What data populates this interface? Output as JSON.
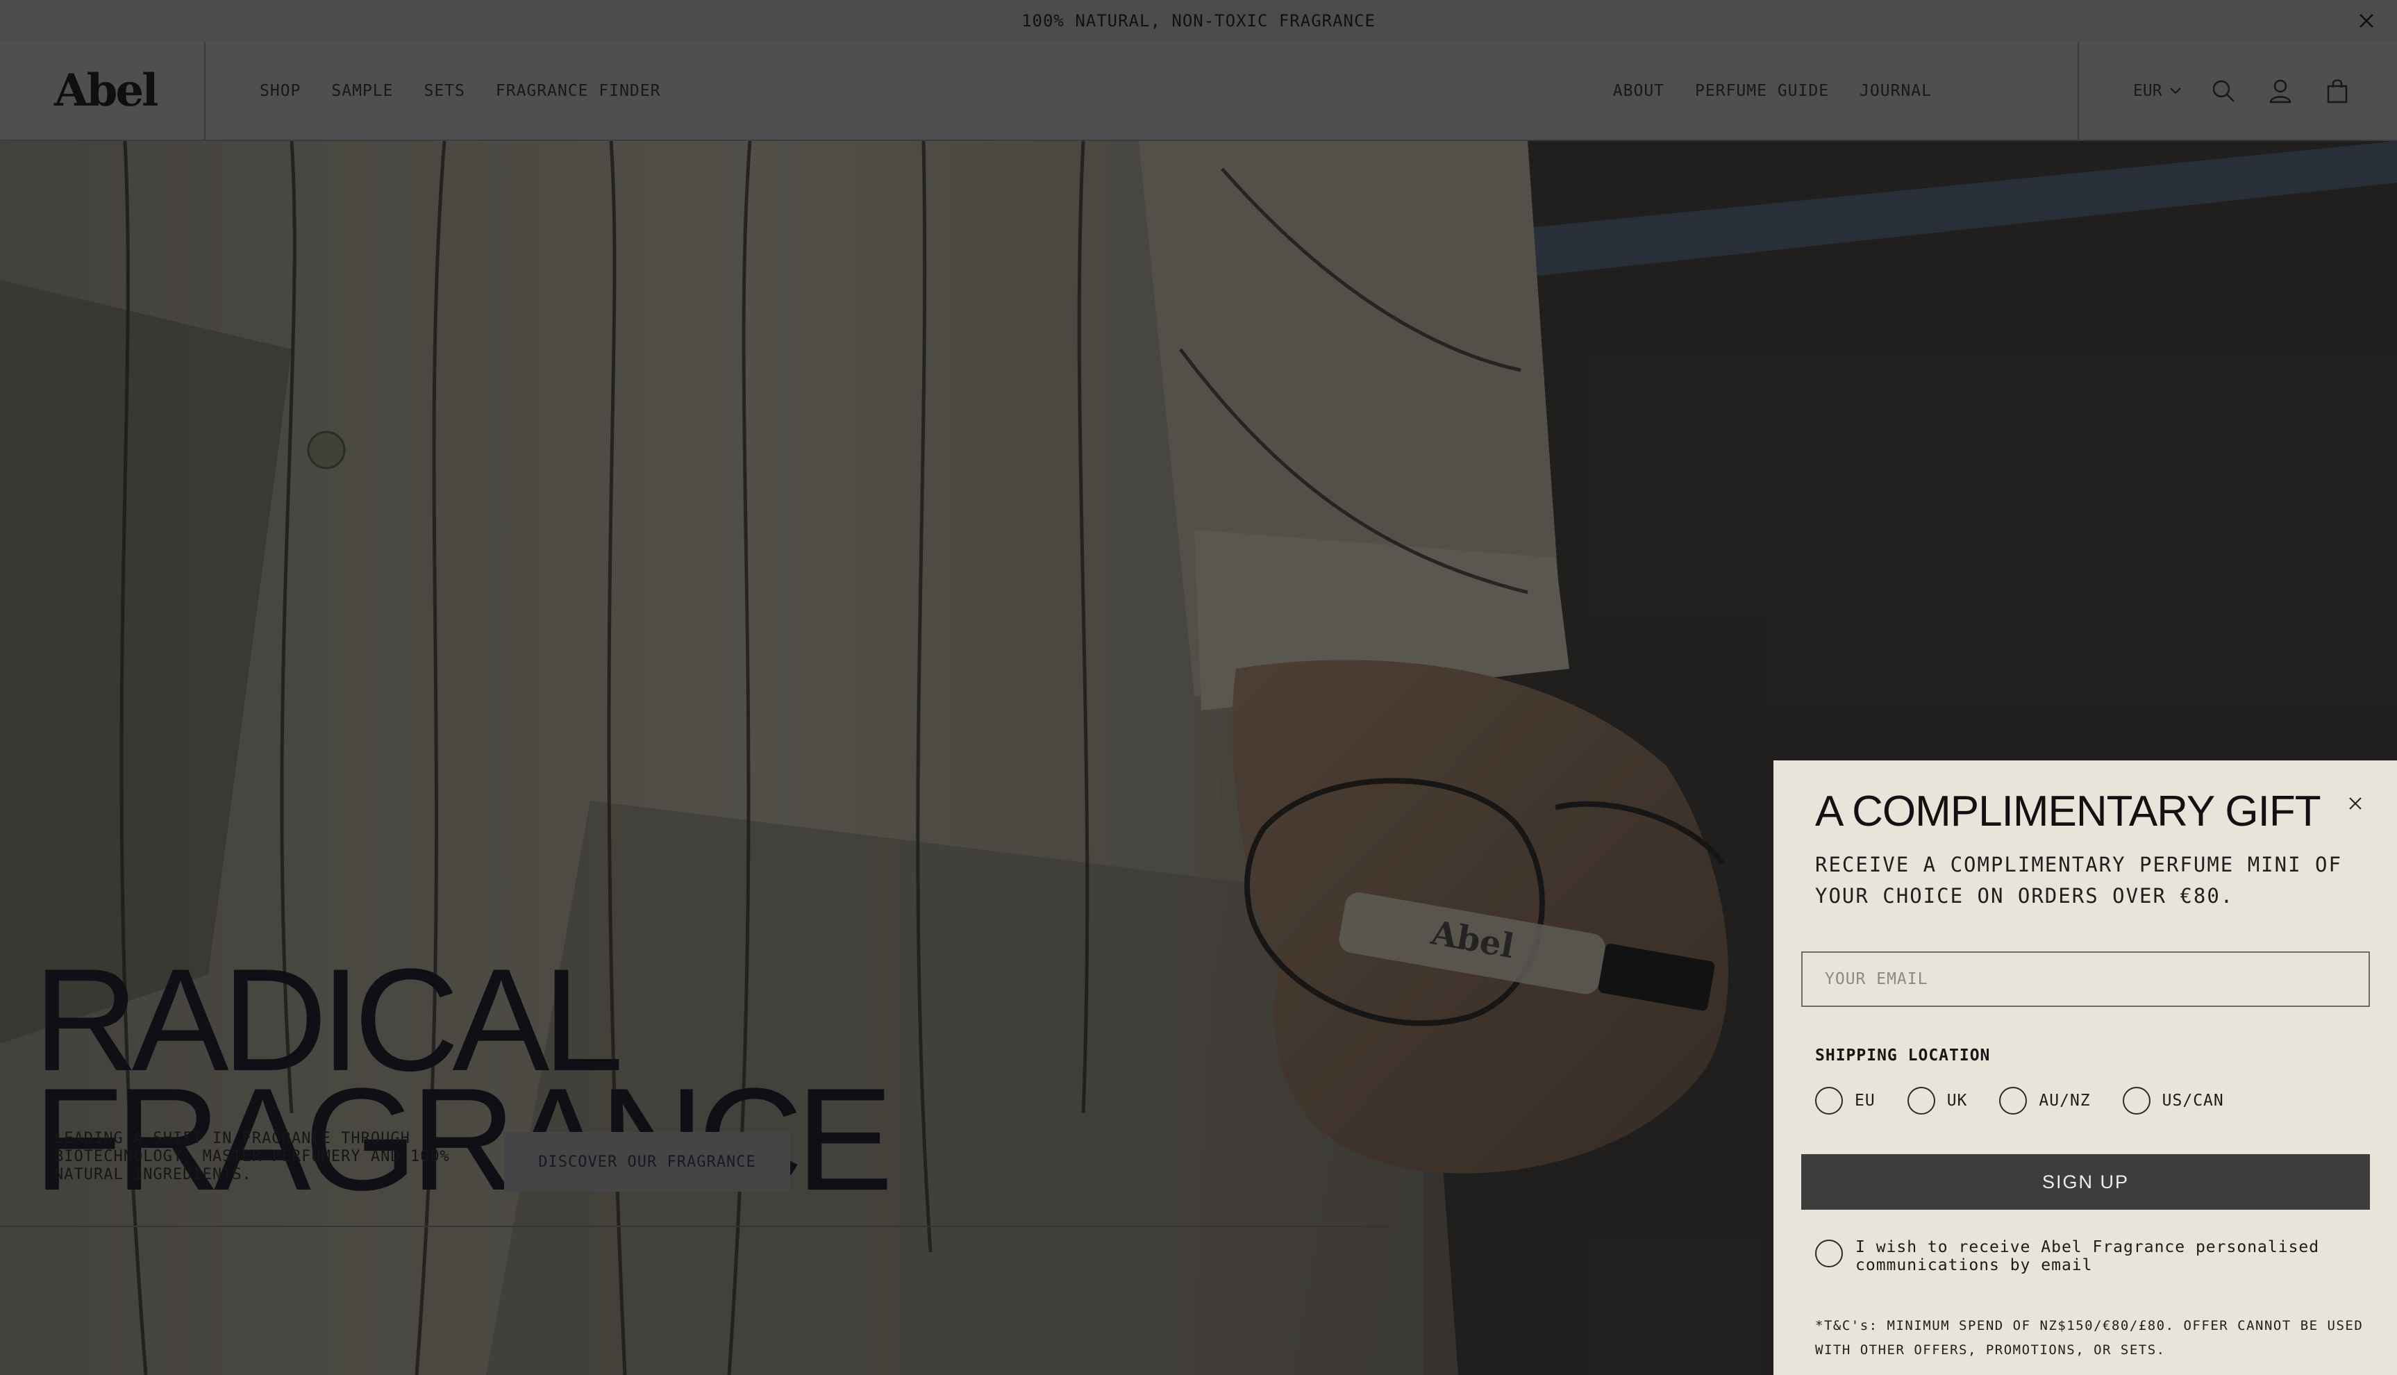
{
  "announcement": {
    "text": "100% NATURAL, NON-TOXIC FRAGRANCE"
  },
  "header": {
    "logo": "Abel",
    "nav_left": [
      "SHOP",
      "SAMPLE",
      "SETS",
      "FRAGRANCE FINDER"
    ],
    "nav_right": [
      "ABOUT",
      "PERFUME GUIDE",
      "JOURNAL"
    ],
    "currency": "EUR",
    "icons": [
      "search-icon",
      "account-icon",
      "cart-icon"
    ]
  },
  "hero": {
    "title_line1": "RADICAL",
    "title_line2": "FRAGRANCE",
    "subtitle": "LEADING A SHIFT IN FRAGRANCE THROUGH BIOTECHNOLOGY, MASTER PERFUMERY AND 100% NATURAL INGREDIENTS.",
    "cta": "DISCOVER OUR FRAGRANCE",
    "bottle_label": "Abel"
  },
  "popup": {
    "title": "A COMPLIMENTARY GIFT",
    "text": "RECEIVE A COMPLIMENTARY PERFUME MINI OF YOUR CHOICE ON ORDERS OVER €80.",
    "email_placeholder": "YOUR EMAIL",
    "shipping_label": "SHIPPING LOCATION",
    "shipping_options": [
      "EU",
      "UK",
      "AU/NZ",
      "US/CAN"
    ],
    "signup": "SIGN UP",
    "consent": "I wish to receive Abel Fragrance personalised communications by email",
    "terms": "*T&C's: MINIMUM SPEND OF NZ$150/€80/£80. OFFER CANNOT BE USED WITH OTHER OFFERS, PROMOTIONS, OR SETS."
  },
  "colors": {
    "popup_bg": "#e8e4da",
    "signup_bg": "#3d3d3d",
    "announcement_bg": "#575757"
  }
}
